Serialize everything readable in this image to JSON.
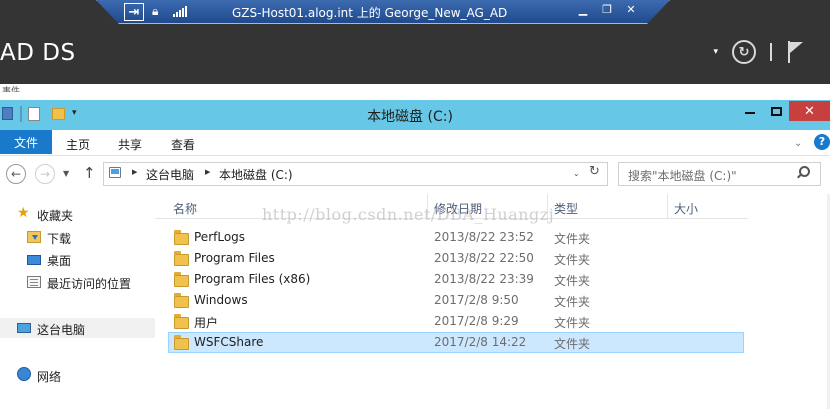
{
  "rdp": {
    "title": "GZS-Host01.alog.int 上的 George_New_AG_AD",
    "pin_symbol": "⇥",
    "min_symbol": "▁",
    "restore_symbol": "❐",
    "close_symbol": "✕"
  },
  "server_manager": {
    "title": "AD DS",
    "cut_text": "事件"
  },
  "explorer": {
    "window_title": "本地磁盘 (C:)",
    "ribbon_tabs": [
      "文件",
      "主页",
      "共享",
      "查看"
    ],
    "address": {
      "crumbs": [
        "这台电脑",
        "本地磁盘 (C:)"
      ]
    },
    "search_placeholder": "搜索\"本地磁盘 (C:)\"",
    "sidebar": {
      "favorites": "收藏夹",
      "downloads": "下载",
      "desktop": "桌面",
      "recent": "最近访问的位置",
      "this_pc": "这台电脑",
      "network": "网络"
    },
    "columns": [
      "名称",
      "修改日期",
      "类型",
      "大小"
    ],
    "files": [
      {
        "name": "PerfLogs",
        "date": "2013/8/22 23:52",
        "type": "文件夹"
      },
      {
        "name": "Program Files",
        "date": "2013/8/22 22:50",
        "type": "文件夹"
      },
      {
        "name": "Program Files (x86)",
        "date": "2013/8/22 23:39",
        "type": "文件夹"
      },
      {
        "name": "Windows",
        "date": "2017/2/8 9:50",
        "type": "文件夹"
      },
      {
        "name": "用户",
        "date": "2017/2/8 9:29",
        "type": "文件夹"
      },
      {
        "name": "WSFCShare",
        "date": "2017/2/8 14:22",
        "type": "文件夹",
        "selected": true
      }
    ]
  },
  "watermark": "http://blog.csdn.net/DBA_Huangzj"
}
